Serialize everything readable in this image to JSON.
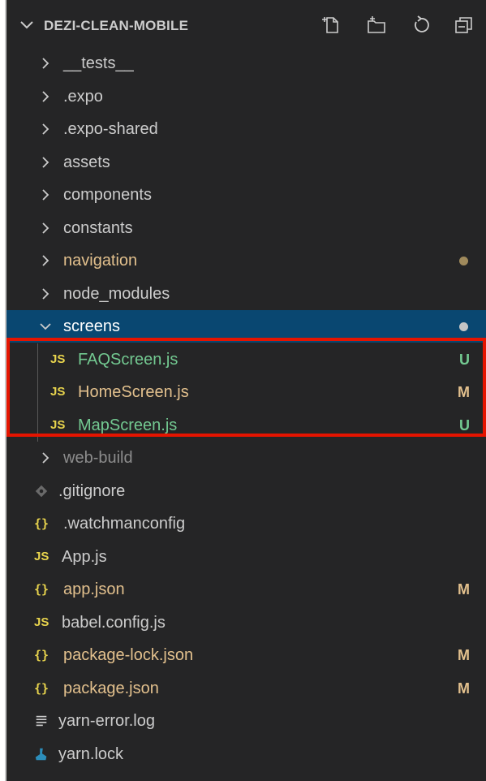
{
  "explorer": {
    "title": "DEZI-CLEAN-MOBILE",
    "header_actions": [
      "new-file",
      "new-folder",
      "refresh",
      "collapse-all"
    ],
    "items": [
      {
        "name": "__tests__",
        "type": "folder",
        "expanded": false
      },
      {
        "name": ".expo",
        "type": "folder",
        "expanded": false
      },
      {
        "name": ".expo-shared",
        "type": "folder",
        "expanded": false
      },
      {
        "name": "assets",
        "type": "folder",
        "expanded": false
      },
      {
        "name": "components",
        "type": "folder",
        "expanded": false
      },
      {
        "name": "constants",
        "type": "folder",
        "expanded": false
      },
      {
        "name": "navigation",
        "type": "folder",
        "expanded": false,
        "status": "modified-dot"
      },
      {
        "name": "node_modules",
        "type": "folder",
        "expanded": false
      },
      {
        "name": "screens",
        "type": "folder",
        "expanded": true,
        "selected": true,
        "status": "dot"
      },
      {
        "name": "FAQScreen.js",
        "type": "js",
        "status": "U"
      },
      {
        "name": "HomeScreen.js",
        "type": "js",
        "status": "M"
      },
      {
        "name": "MapScreen.js",
        "type": "js",
        "status": "U"
      },
      {
        "name": "web-build",
        "type": "folder",
        "expanded": false,
        "ignored": true
      },
      {
        "name": ".gitignore",
        "type": "git"
      },
      {
        "name": ".watchmanconfig",
        "type": "json"
      },
      {
        "name": "App.js",
        "type": "js"
      },
      {
        "name": "app.json",
        "type": "json",
        "status": "M"
      },
      {
        "name": "babel.config.js",
        "type": "js"
      },
      {
        "name": "package-lock.json",
        "type": "json",
        "status": "M"
      },
      {
        "name": "package.json",
        "type": "json",
        "status": "M"
      },
      {
        "name": "yarn-error.log",
        "type": "log"
      },
      {
        "name": "yarn.lock",
        "type": "yarn"
      }
    ]
  },
  "icons": {
    "js": "JS",
    "json": "{}"
  },
  "colors": {
    "background": "#252526",
    "selected_row": "#094771",
    "untracked": "#73c991",
    "modified": "#e2c08d",
    "ignored": "#8c8c8c",
    "default_text": "#cccccc",
    "highlight_border": "#e51400"
  }
}
